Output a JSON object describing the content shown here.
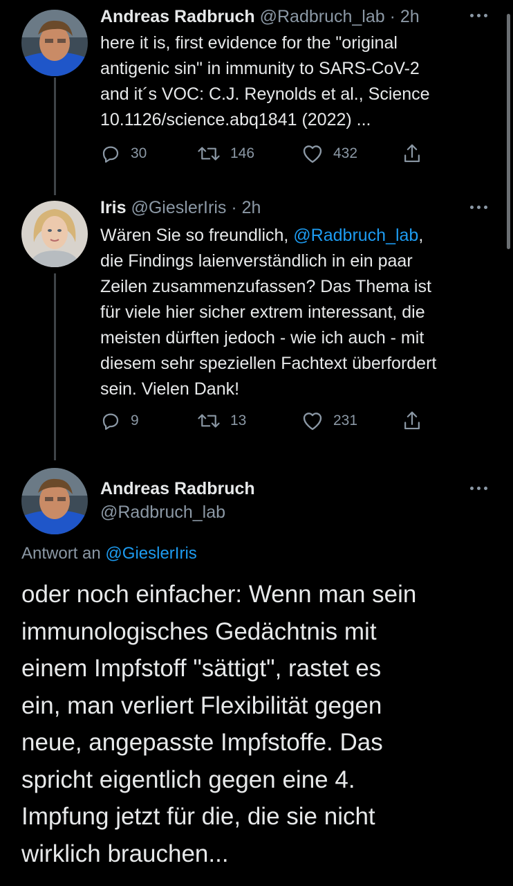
{
  "tweet1": {
    "name": "Andreas Radbruch",
    "handle": "@Radbruch_lab",
    "time": "· 2h",
    "lines": [
      "here it is, first evidence for the \"original",
      "antigenic sin\" in immunity to SARS-CoV-2",
      "and it´s VOC: C.J. Reynolds et al., Science",
      "10.1126/science.abq1841 (2022) ..."
    ],
    "replies": "30",
    "retweets": "146",
    "likes": "432"
  },
  "tweet2": {
    "name": "Iris",
    "handle": "@GieslerIris",
    "time": "· 2h",
    "line1_prefix": "Wären Sie so freundlich, ",
    "line1_mention": "@Radbruch_lab",
    "line1_suffix": ",",
    "lines": [
      "die Findings laienverständlich in ein paar",
      "Zeilen zusammenzufassen? Das Thema ist",
      "für viele hier sicher extrem interessant, die",
      "meisten dürften jedoch - wie ich auch - mit",
      "diesem sehr speziellen Fachtext überfordert",
      "sein. Vielen Dank!"
    ],
    "replies": "9",
    "retweets": "13",
    "likes": "231"
  },
  "tweet3": {
    "name": "Andreas Radbruch",
    "handle": "@Radbruch_lab",
    "reply_to_label": "Antwort an",
    "reply_to_handle": "@GieslerIris",
    "lines": [
      "oder noch einfacher: Wenn man sein",
      "immunologisches Gedächtnis mit",
      "einem Impfstoff \"sättigt\", rastet es",
      "ein, man verliert Flexibilität gegen",
      "neue, angepasste Impfstoffe. Das",
      "spricht eigentlich gegen eine 4.",
      "Impfung jetzt für die, die sie nicht",
      "wirklich brauchen..."
    ]
  },
  "icons": {
    "reply": "reply-icon",
    "retweet": "retweet-icon",
    "like": "heart-icon",
    "share": "share-icon",
    "more": "more-icon"
  },
  "colors": {
    "background": "#000000",
    "text": "#e7e9ea",
    "muted": "#8b98a5",
    "link": "#1d9bf0",
    "thread_line": "#3f4448"
  }
}
